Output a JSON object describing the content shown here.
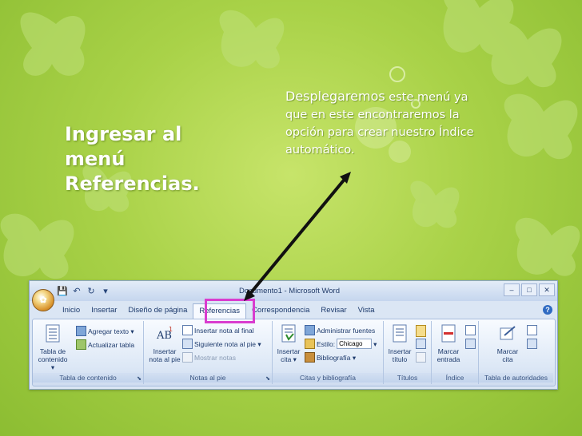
{
  "slide": {
    "title_lines": [
      "Ingresar al",
      "menú",
      "Referencias."
    ],
    "description": {
      "lead": "Desplegaremos",
      "rest_line1": " este menú ya",
      "line2": "que en este encontraremos la",
      "line3": "opción para crear nuestro Índice",
      "line4": "automático."
    }
  },
  "word": {
    "window_title": "Documento1 - Microsoft Word",
    "qat_icons": [
      "save-icon",
      "undo-icon",
      "redo-icon",
      "customize-icon"
    ],
    "tabs": [
      "Inicio",
      "Insertar",
      "Diseño de página",
      "Referencias",
      "Correspondencia",
      "Revisar",
      "Vista"
    ],
    "active_tab": "Referencias",
    "groups": {
      "toc": {
        "label": "Tabla de contenido",
        "big_button": [
          "Tabla de",
          "contenido ▾"
        ],
        "items": [
          "Agregar texto ▾",
          "Actualizar tabla"
        ]
      },
      "footnotes": {
        "label": "Notas al pie",
        "big_button": [
          "Insertar",
          "nota al pie"
        ],
        "items": [
          "Insertar nota al final",
          "Siguiente nota al pie ▾",
          "Mostrar notas"
        ]
      },
      "citations": {
        "label": "Citas y bibliografía",
        "big_button": [
          "Insertar",
          "cita ▾"
        ],
        "items": [
          "Administrar fuentes",
          "Estilo:",
          "Bibliografía ▾"
        ],
        "style_value": "Chicago"
      },
      "captions": {
        "label": "Títulos",
        "big_button": [
          "Insertar",
          "título"
        ]
      },
      "index": {
        "label": "Índice",
        "big_button": [
          "Marcar",
          "entrada"
        ]
      },
      "authorities": {
        "label": "Tabla de autoridades",
        "big_button": [
          "Marcar",
          "cita"
        ]
      }
    }
  },
  "colors": {
    "background": "#a9d248",
    "highlight_box": "#d93ccf",
    "arrow": "#111111"
  }
}
